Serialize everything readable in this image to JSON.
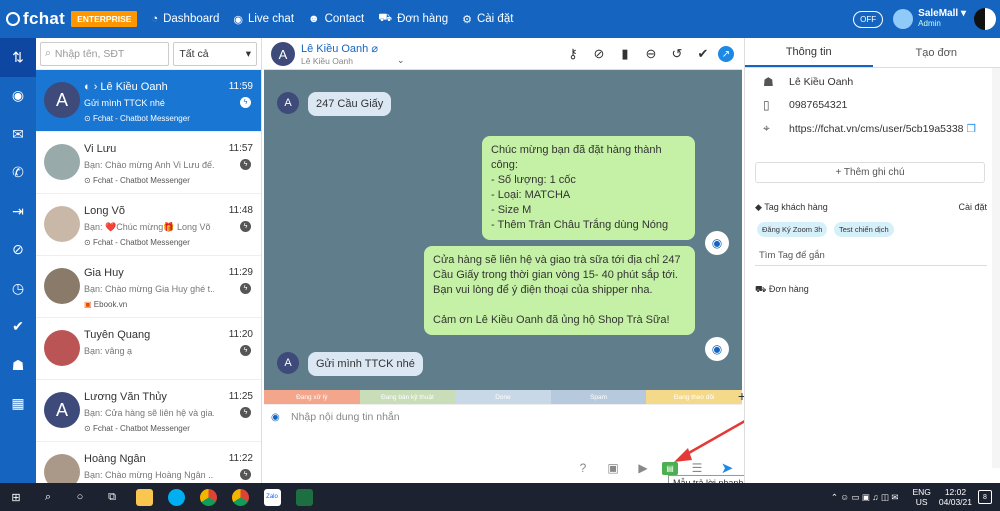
{
  "topbar": {
    "logo": "fchat",
    "badge": "ENTERPRISE",
    "nav": [
      {
        "icon": "dashboard-icon",
        "label": "Dashboard"
      },
      {
        "icon": "messenger-icon",
        "label": "Live chat"
      },
      {
        "icon": "contact-icon",
        "label": "Contact"
      },
      {
        "icon": "cart-icon",
        "label": "Đơn hàng"
      },
      {
        "icon": "gear-icon",
        "label": "Cài đặt"
      }
    ],
    "off": "OFF",
    "user_name": "SaleMall",
    "user_role": "Admin"
  },
  "conv_list": {
    "search_placeholder": "Nhập tên, SĐT",
    "filter": "Tất cả",
    "items": [
      {
        "initial": "A",
        "name": "Lê Kiều Oanh",
        "time": "11:59",
        "preview": "Gửi mình TTCK nhé",
        "source": "Fchat - Chatbot Messenger"
      },
      {
        "initial": "",
        "name": "Vi Lưu",
        "time": "11:57",
        "preview": "Bạn: Chào mừng Anh Vi Lưu đế...",
        "source": "Fchat - Chatbot Messenger"
      },
      {
        "initial": "",
        "name": "Long Võ",
        "time": "11:48",
        "preview": "Bạn: ❤️Chúc mừng🎁 Long Võ ...",
        "source": "Fchat - Chatbot Messenger"
      },
      {
        "initial": "",
        "name": "Gia Huy",
        "time": "11:29",
        "preview": "Bạn: Chào mừng Gia Huy ghé t...",
        "source": "Ebook.vn"
      },
      {
        "initial": "",
        "name": "Tuyên Quang",
        "time": "11:20",
        "preview": "Bạn: vâng ạ",
        "source": ""
      },
      {
        "initial": "A",
        "name": "Lương Văn Thủy",
        "time": "11:25",
        "preview": "Bạn: Cửa hàng sẽ liên hệ và gia...",
        "source": "Fchat - Chatbot Messenger"
      },
      {
        "initial": "",
        "name": "Hoàng Ngân",
        "time": "11:22",
        "preview": "Bạn: Chào mừng Hoàng Ngân ...",
        "source": ""
      }
    ]
  },
  "chat": {
    "name": "Lê Kiều Oanh",
    "sub": "Lê Kiều Oanh",
    "initial": "A",
    "messages": [
      {
        "dir": "in",
        "text": "247 Cầu Giấy"
      },
      {
        "dir": "out",
        "text": "Chúc mừng bạn đã đặt hàng thành công:\n- Số lượng: 1 cốc\n- Loại: MATCHA\n- Size M\n- Thêm Trân Châu Trắng dùng Nóng"
      },
      {
        "dir": "out",
        "text": "Cửa hàng sẽ liên hệ và giao trà sữa tới địa chỉ 247\nCầu Giấy trong thời gian vòng 15- 40 phút sắp tới.\nBạn vui lòng để ý điện thoại của shipper nha.\n\nCảm ơn Lê Kiều Oanh đã ủng hộ Shop Trà Sữa!"
      },
      {
        "dir": "in",
        "text": "Gửi mình TTCK nhé"
      }
    ],
    "tags": [
      {
        "label": "Đang xử lý",
        "color": "#f4a68c"
      },
      {
        "label": "Đang bàn kỹ thuật",
        "color": "#c8ddb8"
      },
      {
        "label": "Done",
        "color": "#c9d8e6"
      },
      {
        "label": "Spam",
        "color": "#b7c9dc"
      },
      {
        "label": "Đang theo dõi",
        "color": "#f5d98a"
      }
    ],
    "input_placeholder": "Nhập nội dung tin nhắn",
    "tooltip": "Mẫu trả lời nhanh"
  },
  "right": {
    "tabs": [
      "Thông tin",
      "Tạo đơn"
    ],
    "name": "Lê Kiều Oanh",
    "phone": "0987654321",
    "url": "https://fchat.vn/cms/user/5cb19a5338",
    "add_note": "+ Thêm ghi chú",
    "tag_section": "Tag khách hàng",
    "tag_setting": "Cài đặt",
    "chips": [
      "Đăng Ký Zoom 3h",
      "Test chiến dịch"
    ],
    "tag_search": "Tìm Tag để gắn",
    "orders": "Đơn hàng"
  },
  "taskbar": {
    "lang1": "ENG",
    "lang2": "US",
    "time": "12:02",
    "date": "04/03/21",
    "notif": "8"
  }
}
